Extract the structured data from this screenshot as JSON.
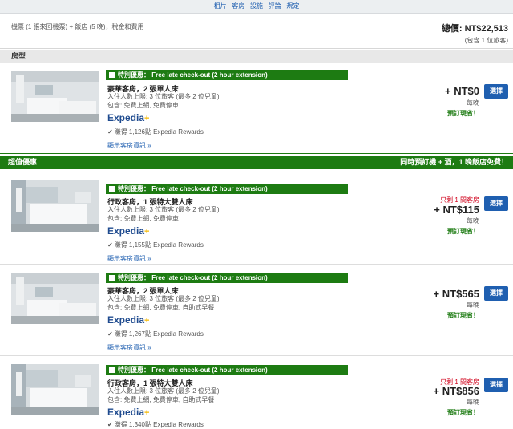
{
  "nav": {
    "items": [
      "相片",
      "客房",
      "設施",
      "評論",
      "規定"
    ],
    "sep": "·"
  },
  "summary": {
    "description": "機票 (1 張來回機票) + 飯店 (5 晚)，稅金和費用",
    "total_label": "總價: NT$22,513",
    "total_note": "(包含 1 位旅客)"
  },
  "sections": {
    "room_type": "房型",
    "deals_title": "超值優惠",
    "deals_right": "同時預訂機 + 酒，1 晚飯店免費！"
  },
  "common": {
    "promo_text": "特別優惠： Free late check-out (2 hour extension)",
    "expedia_brand": "Expedia",
    "expedia_plus": "+",
    "more_link": "顯示客房資訊 »",
    "per_night": "每晚",
    "book_now": "預訂現省！",
    "select_label": "選擇",
    "scarcity": "只剩 1 間客房"
  },
  "rooms": [
    {
      "name": "豪華客房，2 張單人床",
      "occupancy": "入住人數上限: 3 位旅客 (最多 2 位兒童)",
      "includes": "包含: 免費上網, 免費停車",
      "reward": "賺得 1,126點 Expedia Rewards",
      "price": "+ NT$0"
    },
    {
      "name": "行政客房，1 張特大雙人床",
      "occupancy": "入住人數上限: 3 位旅客 (最多 2 位兒童)",
      "includes": "包含: 免費上網, 免費停車",
      "reward": "賺得 1,155點 Expedia Rewards",
      "price": "+ NT$115"
    },
    {
      "name": "豪華客房，2 張單人床",
      "occupancy": "入住人數上限: 3 位旅客 (最多 2 位兒童)",
      "includes": "包含: 免費上網, 免費停車, 自助式早餐",
      "reward": "賺得 1,267點 Expedia Rewards",
      "price": "+ NT$565"
    },
    {
      "name": "行政客房，1 張特大雙人床",
      "occupancy": "入住人數上限: 3 位旅客 (最多 2 位兒童)",
      "includes": "包含: 免費上網, 免費停車, 自助式早餐",
      "reward": "賺得 1,340點 Expedia Rewards",
      "price": "+ NT$856"
    }
  ]
}
